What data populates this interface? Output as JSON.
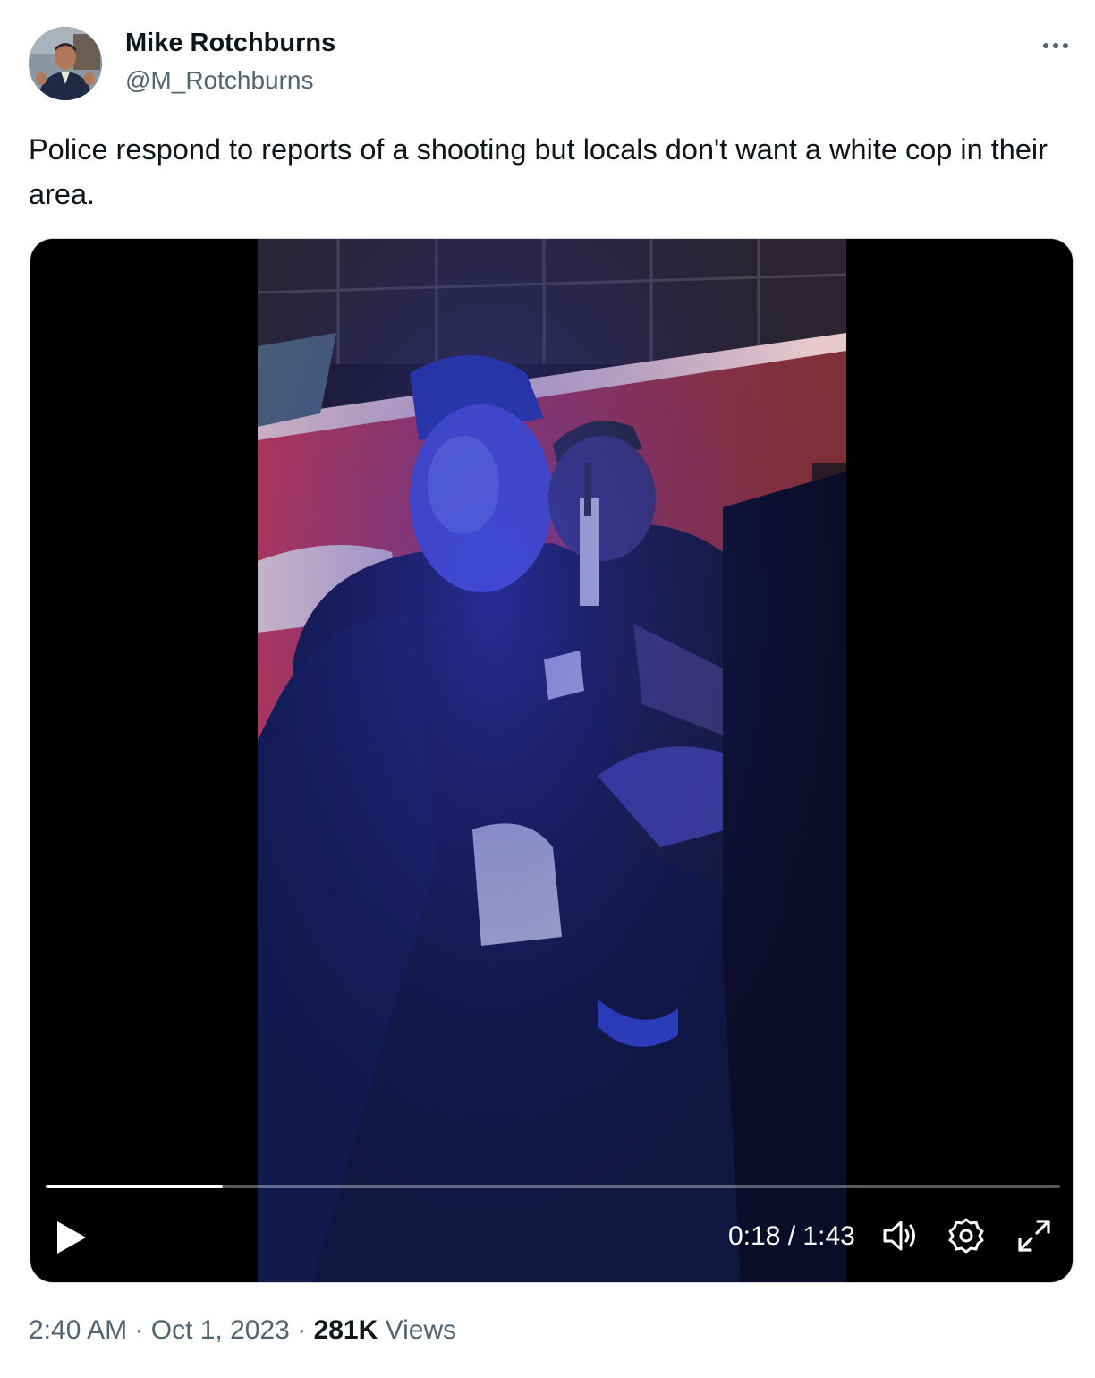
{
  "author": {
    "name": "Mike Rotchburns",
    "handle": "@M_Rotchburns",
    "avatar_icon": "profile-photo"
  },
  "tweet": {
    "text": "Police respond to reports of a shooting but locals don't want a white cop in their area."
  },
  "video": {
    "current_time": "0:18",
    "separator": "/",
    "duration": "1:43",
    "progress_fraction": 0.175,
    "icons": [
      "play-icon",
      "volume-icon",
      "settings-icon",
      "fullscreen-icon"
    ]
  },
  "meta": {
    "time": "2:40 AM",
    "dot1": "·",
    "date": "Oct 1, 2023",
    "dot2": "·",
    "views_count": "281K",
    "views_label": "Views"
  },
  "colors": {
    "text_primary": "#0f1419",
    "text_secondary": "#536471",
    "video_bg": "#000000"
  }
}
